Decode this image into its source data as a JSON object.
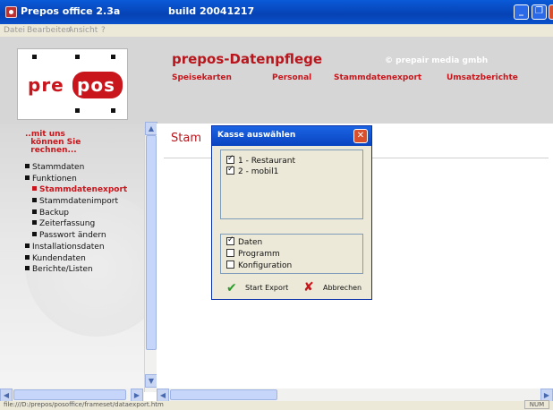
{
  "window": {
    "title": "Prepos office 2.3a",
    "build": "build 20041217",
    "minimize_icon": "minimize-icon",
    "maximize_icon": "maximize-icon",
    "close_icon": "close-icon"
  },
  "menu": [
    "Datei",
    "Bearbeiten",
    "Ansicht",
    "?"
  ],
  "header": {
    "logo_left": "pre",
    "logo_right": "pos",
    "title": "prepos-Datenpflege",
    "company": "© prepair media gmbh",
    "nav": [
      "Speisekarten",
      "Personal",
      "Stammdatenexport",
      "Umsatzberichte"
    ]
  },
  "sidebar": {
    "intro": "..mit uns\n  können Sie\n  rechnen...",
    "items": [
      {
        "label": "Stammdaten",
        "level": 0,
        "active": false
      },
      {
        "label": "Funktionen",
        "level": 0,
        "active": false
      },
      {
        "label": "Stammdatenexport",
        "level": 1,
        "active": true
      },
      {
        "label": "Stammdatenimport",
        "level": 1,
        "active": false
      },
      {
        "label": "Backup",
        "level": 1,
        "active": false
      },
      {
        "label": "Zeiterfassung",
        "level": 1,
        "active": false
      },
      {
        "label": "Passwort ändern",
        "level": 1,
        "active": false
      },
      {
        "label": "Installationsdaten",
        "level": 0,
        "active": false
      },
      {
        "label": "Kundendaten",
        "level": 0,
        "active": false
      },
      {
        "label": "Berichte/Listen",
        "level": 0,
        "active": false
      }
    ]
  },
  "main": {
    "page_title": "Stam"
  },
  "dialog": {
    "title": "Kasse auswählen",
    "kassen": [
      {
        "label": "1 - Restaurant",
        "checked": true
      },
      {
        "label": "2 - mobil1",
        "checked": true
      }
    ],
    "options": [
      {
        "label": "Daten",
        "checked": true
      },
      {
        "label": "Programm",
        "checked": false
      },
      {
        "label": "Konfiguration",
        "checked": false
      }
    ],
    "export_label": "Start Export",
    "cancel_label": "Abbrechen",
    "export_icon": "checkmark-icon",
    "cancel_icon": "red-x-icon"
  },
  "status": {
    "url": "file:///D:/prepos/posoffice/frameset/dataexport.htm",
    "num": "NUM"
  }
}
